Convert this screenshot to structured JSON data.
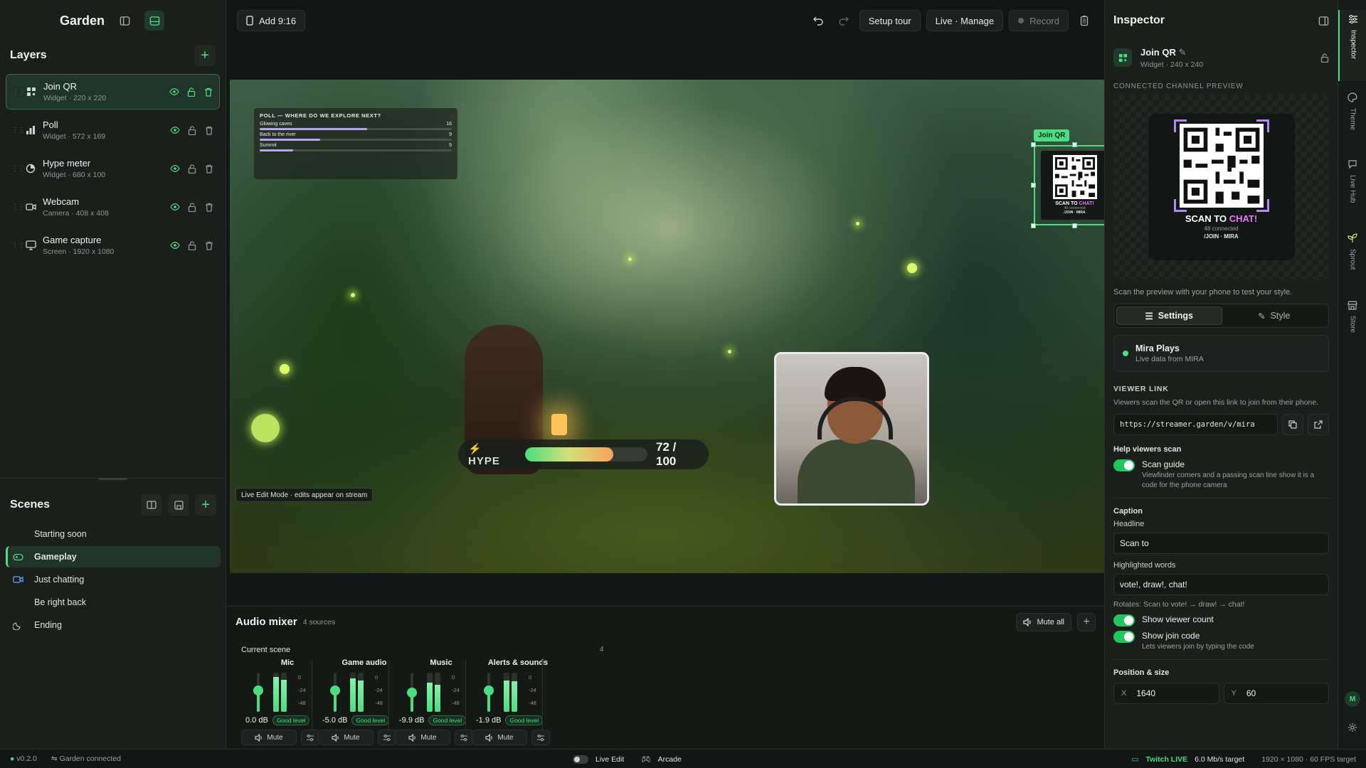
{
  "app": {
    "name": "Garden"
  },
  "layers": {
    "title": "Layers",
    "items": [
      {
        "name": "Join QR",
        "meta": "Widget · 220 x 220",
        "icon": "qr-icon"
      },
      {
        "name": "Poll",
        "meta": "Widget · 572 x 169",
        "icon": "bar-chart-icon"
      },
      {
        "name": "Hype meter",
        "meta": "Widget · 680 x 100",
        "icon": "gauge-icon"
      },
      {
        "name": "Webcam",
        "meta": "Camera · 408 x 408",
        "icon": "camera-icon"
      },
      {
        "name": "Game capture",
        "meta": "Screen · 1920 x 1080",
        "icon": "monitor-icon"
      }
    ]
  },
  "scenes": {
    "title": "Scenes",
    "items": [
      {
        "name": "Starting soon",
        "icon": ""
      },
      {
        "name": "Gameplay",
        "icon": "gamepad-icon"
      },
      {
        "name": "Just chatting",
        "icon": "video-icon"
      },
      {
        "name": "Be right back",
        "icon": ""
      },
      {
        "name": "Ending",
        "icon": "moon-icon"
      }
    ]
  },
  "topbar": {
    "add_label": "Add 9:16",
    "setup_tour": "Setup tour",
    "live_manage": "Live · Manage",
    "record": "Record"
  },
  "stage": {
    "poll": {
      "title": "POLL — WHERE DO WE EXPLORE NEXT?",
      "options": [
        {
          "label": "Glowing caves",
          "votes": 16
        },
        {
          "label": "Back to the river",
          "votes": 9
        },
        {
          "label": "Summit",
          "votes": 5
        }
      ]
    },
    "qr": {
      "tag": "Join QR",
      "caption_a": "SCAN TO",
      "caption_b": "CHAT!",
      "connected": "48 connected",
      "code": "/JOIN · MIRA"
    },
    "hype": {
      "label": "HYPE",
      "value_text": "72 / 100",
      "fraction": 0.72
    },
    "badge": "Live Edit Mode · edits appear on stream"
  },
  "mixer": {
    "title": "Audio mixer",
    "count": "4 sources",
    "mute_all": "Mute all",
    "current_scene": "Current scene",
    "num": "4",
    "scale": [
      "0",
      "-24",
      "-48"
    ],
    "mute_label": "Mute",
    "channels": [
      {
        "name": "Mic",
        "db": "0.0 dB",
        "level": "Good level",
        "fader": 0.55,
        "meter": [
          0.9,
          0.82
        ]
      },
      {
        "name": "Game audio",
        "db": "-5.0 dB",
        "level": "Good level",
        "fader": 0.55,
        "meter": [
          0.85,
          0.8
        ]
      },
      {
        "name": "Music",
        "db": "-9.9 dB",
        "level": "Good level",
        "fader": 0.5,
        "meter": [
          0.75,
          0.7
        ]
      },
      {
        "name": "Alerts & sounds",
        "db": "-1.9 dB",
        "level": "Good level",
        "fader": 0.55,
        "meter": [
          0.8,
          0.78
        ]
      }
    ]
  },
  "inspector": {
    "title": "Inspector",
    "selected": {
      "name": "Join QR",
      "meta": "Widget · 240 x 240"
    },
    "preview_label": "CONNECTED CHANNEL PREVIEW",
    "preview": {
      "caption_a": "SCAN TO",
      "caption_b": "CHAT!",
      "connected": "48 connected",
      "code": "/JOIN · MIRA"
    },
    "hint": "Scan the preview with your phone to test your style.",
    "tabs": {
      "settings": "Settings",
      "style": "Style"
    },
    "channel": {
      "name": "Mira Plays",
      "meta": "Live data from MIRA"
    },
    "viewer_link_title": "VIEWER LINK",
    "viewer_link_desc": "Viewers scan the QR or open this link to join from their phone.",
    "url": "https://streamer.garden/v/mira",
    "help_title": "Help viewers scan",
    "scan_guide": {
      "title": "Scan guide",
      "desc": "Viewfinder corners and a passing scan line show it is a code for the phone camera"
    },
    "caption_title": "Caption",
    "headline_label": "Headline",
    "headline_value": "Scan to",
    "highlight_label": "Highlighted words",
    "highlight_value": "vote!, draw!, chat!",
    "rotates": "Rotates: Scan to vote! → draw! → chat!",
    "show_viewer_count": "Show viewer count",
    "show_join_code": {
      "title": "Show join code",
      "desc": "Lets viewers join by typing the code"
    },
    "position_title": "Position & size",
    "x_label": "X",
    "x_value": "1640",
    "y_label": "Y",
    "y_value": "60"
  },
  "rail": {
    "items": [
      "Inspector",
      "Theme",
      "Live Hub",
      "Sprout",
      "Store"
    ],
    "avatar": "M"
  },
  "status": {
    "version": "v0.2.0",
    "connected": "Garden connected",
    "live_edit": "Live Edit",
    "arcade": "Arcade",
    "twitch": "Twitch LIVE",
    "bitrate": "6.0 Mb/s target",
    "res": "1920 × 1080 · 60 FPS target"
  },
  "colors": {
    "accent": "#4ade80",
    "highlight": "#e879f9",
    "poll_bar": "#b8a3f5"
  }
}
